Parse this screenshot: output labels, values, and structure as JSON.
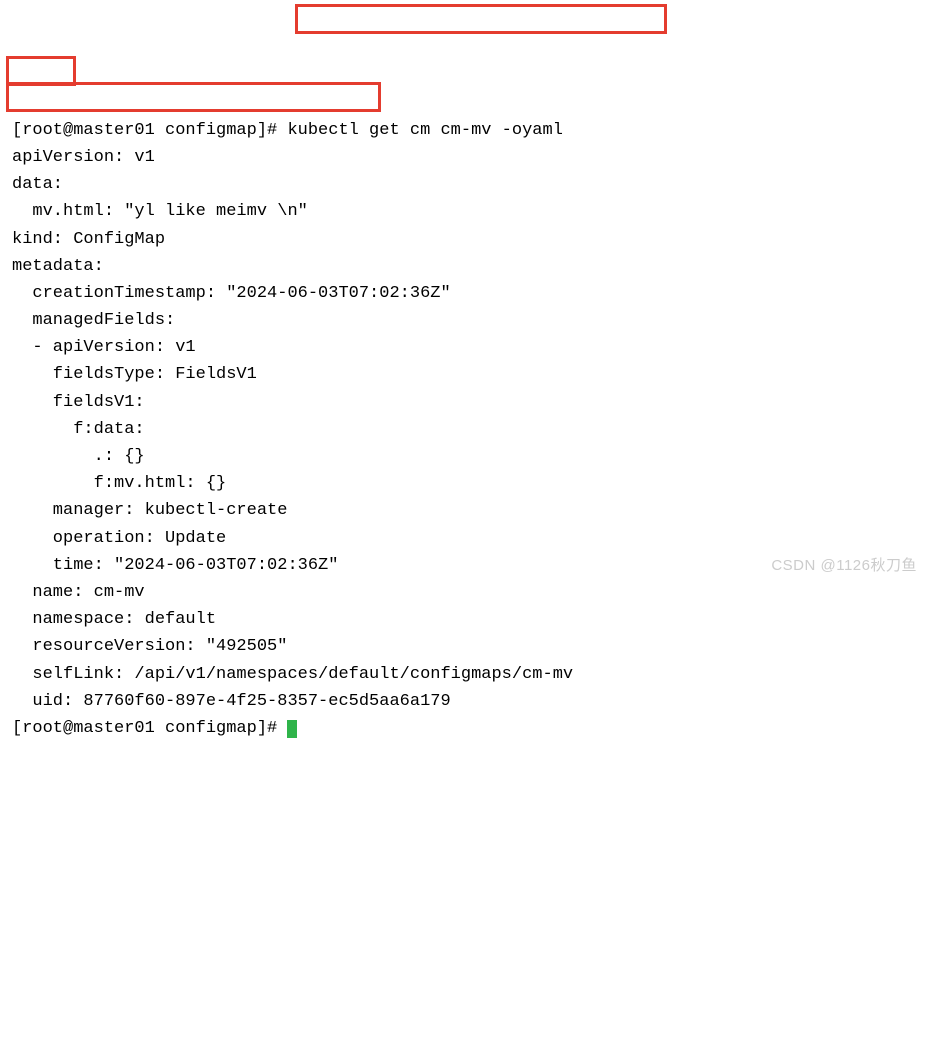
{
  "lines": {
    "l0": "[root@master01 configmap]# kubectl get cm cm-mv -oyaml",
    "l1": "apiVersion: v1",
    "l2": "data:",
    "l3": "  mv.html: \"yl like meimv \\n\"",
    "l4": "kind: ConfigMap",
    "l5": "metadata:",
    "l6": "  creationTimestamp: \"2024-06-03T07:02:36Z\"",
    "l7": "  managedFields:",
    "l8": "  - apiVersion: v1",
    "l9": "    fieldsType: FieldsV1",
    "l10": "    fieldsV1:",
    "l11": "      f:data:",
    "l12": "        .: {}",
    "l13": "        f:mv.html: {}",
    "l14": "    manager: kubectl-create",
    "l15": "    operation: Update",
    "l16": "    time: \"2024-06-03T07:02:36Z\"",
    "l17": "  name: cm-mv",
    "l18": "  namespace: default",
    "l19": "  resourceVersion: \"492505\"",
    "l20": "  selfLink: /api/v1/namespaces/default/configmaps/cm-mv",
    "l21": "  uid: 87760f60-897e-4f25-8357-ec5d5aa6a179",
    "l22": "[root@master01 configmap]# "
  },
  "watermark": "CSDN @1126秋刀鱼"
}
